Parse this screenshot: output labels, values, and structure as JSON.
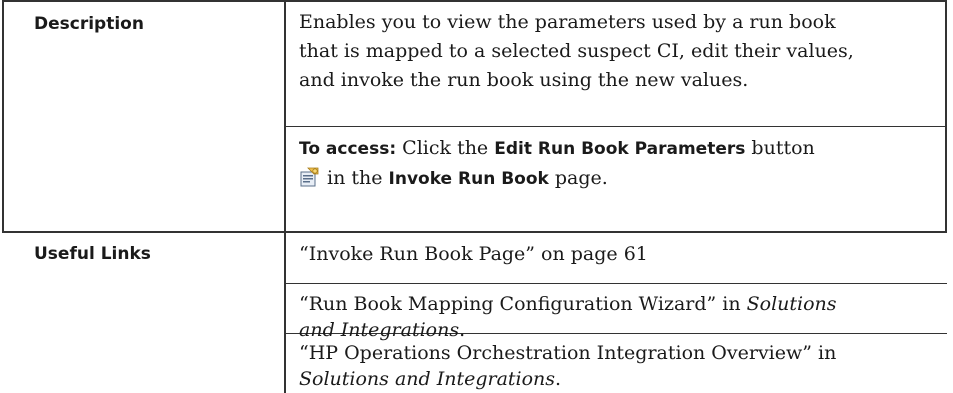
{
  "rows": [
    {
      "label": "Description",
      "paragraphs": [
        {
          "lines": [
            "Enables you to view the parameters used by a run book",
            "that is mapped to a selected suspect CI, edit their values,",
            "and invoke the run book using the new values."
          ]
        },
        {
          "access_label": "To access:",
          "text1": " Click the ",
          "button_name": "Edit Run Book Parameters",
          "text2": " button",
          "line2_text1": "in the ",
          "page_name": "Invoke Run Book",
          "line2_text2": " page.",
          "icon": "edit-parameters-icon"
        }
      ]
    },
    {
      "label": "Useful Links",
      "links": [
        {
          "line1": "“Invoke Run Book Page” on page 61"
        },
        {
          "line1_prefix": "“Run Book Mapping Configuration Wizard” in ",
          "line1_italic": "Solutions",
          "line2_italic": "and Integrations",
          "line2_suffix": "."
        },
        {
          "line1": "“HP Operations Orchestration Integration Overview” in",
          "line2_italic": "Solutions and Integrations",
          "line2_suffix": "."
        }
      ]
    }
  ],
  "colors": {
    "border": "#333333",
    "text": "#1a1a1a"
  }
}
